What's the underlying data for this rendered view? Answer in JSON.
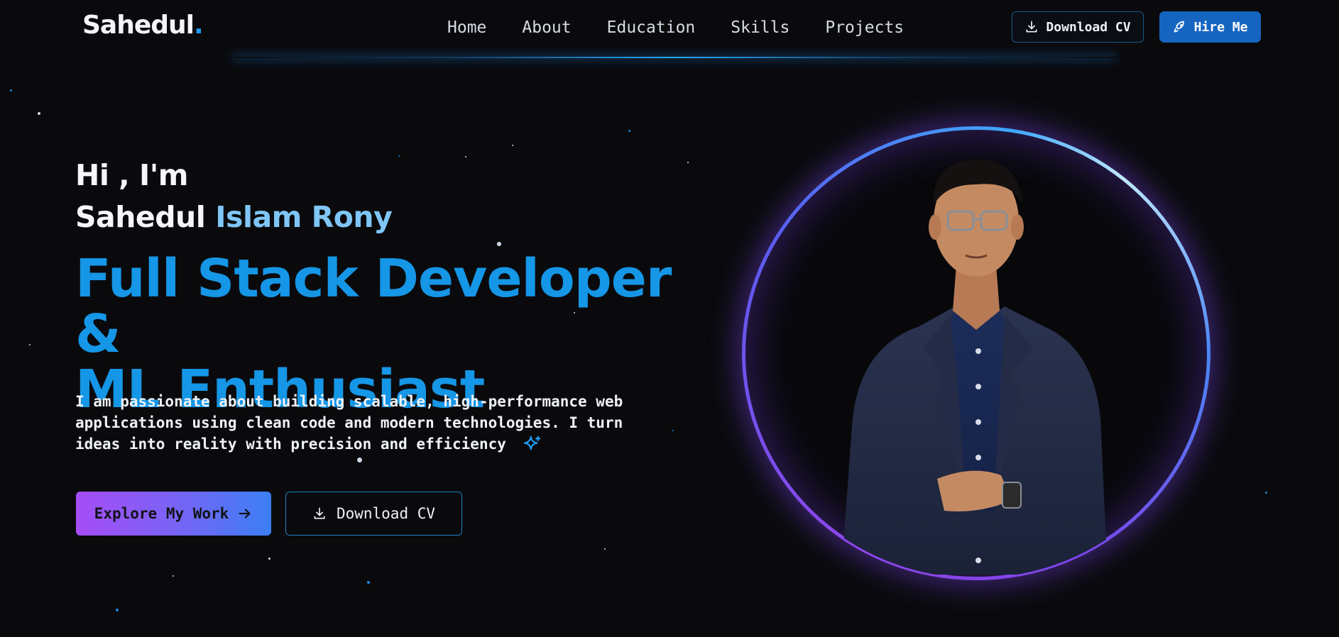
{
  "nav": {
    "logo": "Sahedul",
    "logo_dot": ".",
    "links": [
      "Home",
      "About",
      "Education",
      "Skills",
      "Projects"
    ],
    "download_cv": "Download CV",
    "hire_me": "Hire Me"
  },
  "hero": {
    "greeting": "Hi , I'm",
    "name_first": "Sahedul",
    "name_last": "Islam Rony",
    "role_line1": "Full Stack Developer &",
    "role_line2": "ML Enthusiast",
    "bio": "I am passionate about building scalable, high-performance web applications using clean code and modern technologies. I turn ideas into reality with precision and efficiency",
    "explore_button": "Explore My Work",
    "download_button": "Download CV"
  },
  "colors": {
    "accent_blue": "#1596e6",
    "name_highlight": "#7fc6f6",
    "hire_button": "#1565c0",
    "explore_gradient_start": "#a64df5",
    "explore_gradient_end": "#3b7ff5",
    "background": "#0a0a0d"
  },
  "icons": {
    "download": "download-icon",
    "hire": "rocket-icon",
    "explore": "arrow-right-icon",
    "sparkle": "sparkle-icon"
  }
}
